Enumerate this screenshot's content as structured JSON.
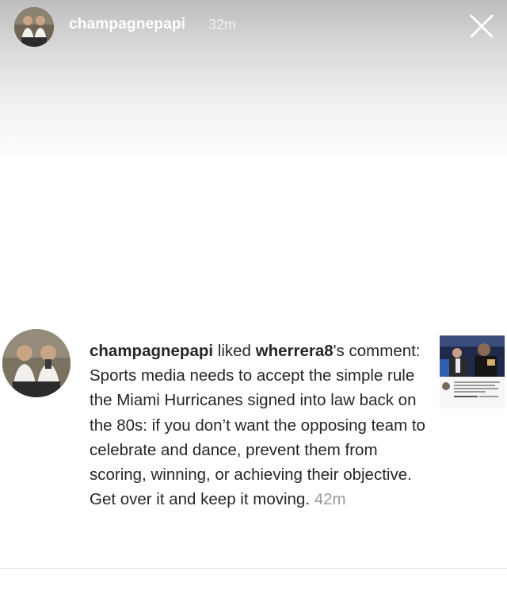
{
  "story": {
    "username": "champagnepapi",
    "time": "32m"
  },
  "activity": {
    "actor": "champagnepapi",
    "verb": " liked ",
    "target": "wherrera8",
    "target_suffix": "'s",
    "comment_prefix": " comment: ",
    "comment": "Sports media needs to accept the simple rule the Miami Hurricanes signed into law back on the 80s: if you don’t want the opposing team to celebrate and dance, prevent them from scoring, winning, or achieving their objective. Get over it and keep it moving.",
    "time": "42m"
  },
  "icons": {
    "close": "close-icon"
  },
  "colors": {
    "text": "#262626",
    "timestamp": "#9a9a9a",
    "header_text": "#ffffff"
  }
}
